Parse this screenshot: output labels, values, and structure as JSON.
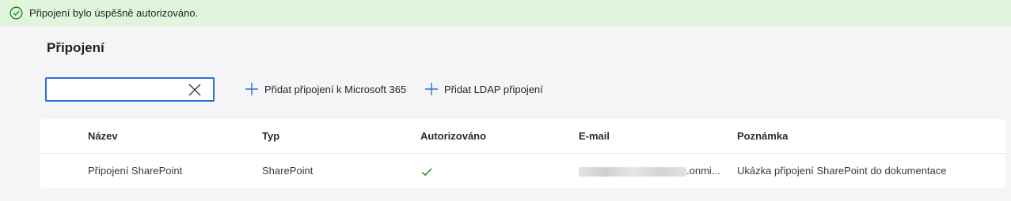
{
  "banner": {
    "message": "Připojení bylo úspěšně autorizováno.",
    "icon": "check-circle-icon",
    "color": "#dff6dd"
  },
  "page": {
    "title": "Připojení"
  },
  "search": {
    "value": "",
    "placeholder": ""
  },
  "toolbar": {
    "add_ms365_label": "Přidat připojení k Microsoft 365",
    "add_ldap_label": "Přidat LDAP připojení"
  },
  "table": {
    "columns": [
      "Název",
      "Typ",
      "Autorizováno",
      "E-mail",
      "Poznámka"
    ],
    "rows": [
      {
        "name": "Připojení SharePoint",
        "type": "SharePoint",
        "authorized": true,
        "email_suffix": ".onmi...",
        "note": "Ukázka připojení SharePoint do dokumentace"
      }
    ]
  },
  "colors": {
    "accent": "#2f6fd6",
    "success": "#107c10"
  }
}
